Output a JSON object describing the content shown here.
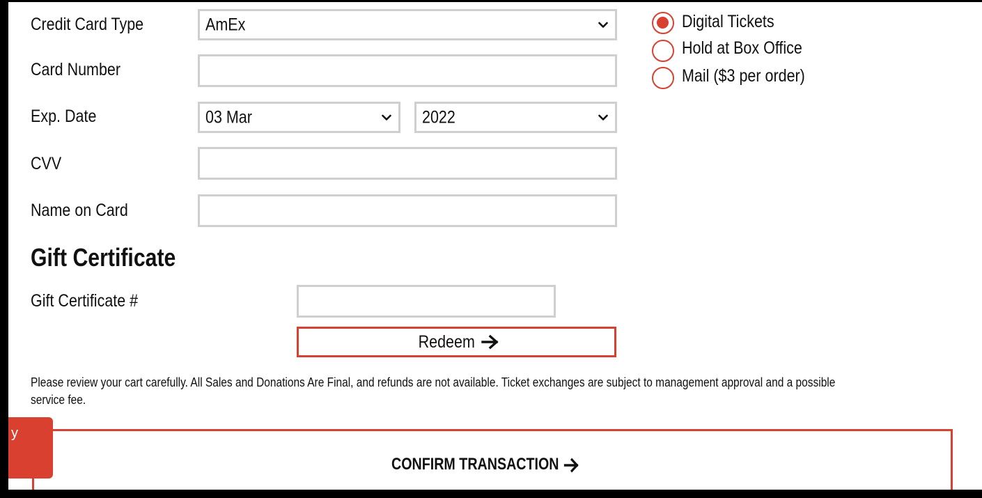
{
  "payment": {
    "card_type_label": "Credit Card Type",
    "card_type_value": "AmEx",
    "card_number_label": "Card Number",
    "card_number_value": "",
    "exp_date_label": "Exp. Date",
    "exp_month_value": "03 Mar",
    "exp_year_value": "2022",
    "cvv_label": "CVV",
    "cvv_value": "",
    "name_label": "Name on Card",
    "name_value": ""
  },
  "delivery": {
    "options": [
      {
        "label": "Digital Tickets",
        "selected": true
      },
      {
        "label": "Hold at Box Office",
        "selected": false
      },
      {
        "label": "Mail ($3 per order)",
        "selected": false
      }
    ]
  },
  "gift_certificate": {
    "title": "Gift Certificate",
    "field_label": "Gift Certificate #",
    "field_value": "",
    "redeem_label": "Redeem"
  },
  "disclaimer": "Please review your cart carefully. All Sales and Donations Are Final, and refunds are not available. Ticket exchanges are subject to management approval and a possible service fee.",
  "confirm": {
    "label": "CONFIRM TRANSACTION"
  },
  "side_tab": {
    "label": "y"
  },
  "colors": {
    "accent": "#d9402f",
    "field_border": "#cfcfcf",
    "text": "#111111"
  }
}
